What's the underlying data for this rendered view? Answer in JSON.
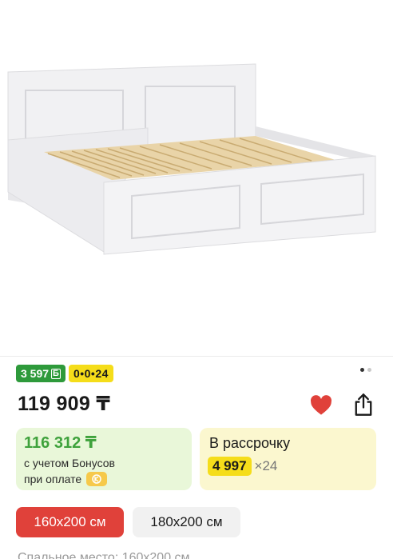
{
  "product": {
    "image_alt": "bed-image"
  },
  "badges": {
    "bonus": "3 597",
    "bonus_currency": "Б",
    "installment": "0•0•24"
  },
  "gallery": {
    "dots": 2,
    "active_dot": 1
  },
  "price": {
    "main": "119 909 ₸"
  },
  "bonus_card": {
    "price": "116 312 ₸",
    "note": "с учетом Бонусов",
    "payment": "при оплате"
  },
  "installment_card": {
    "title": "В рассрочку",
    "amount": "4 997",
    "months": "×24"
  },
  "sizes": {
    "active": "160x200 см",
    "other": "180x200 см"
  },
  "spec": {
    "sleeping_place": "Спальное место: 160x200 см"
  },
  "colors": {
    "accent_red": "#e0413a",
    "bonus_green": "#2e9a3b",
    "install_yellow": "#f5dd1a"
  }
}
